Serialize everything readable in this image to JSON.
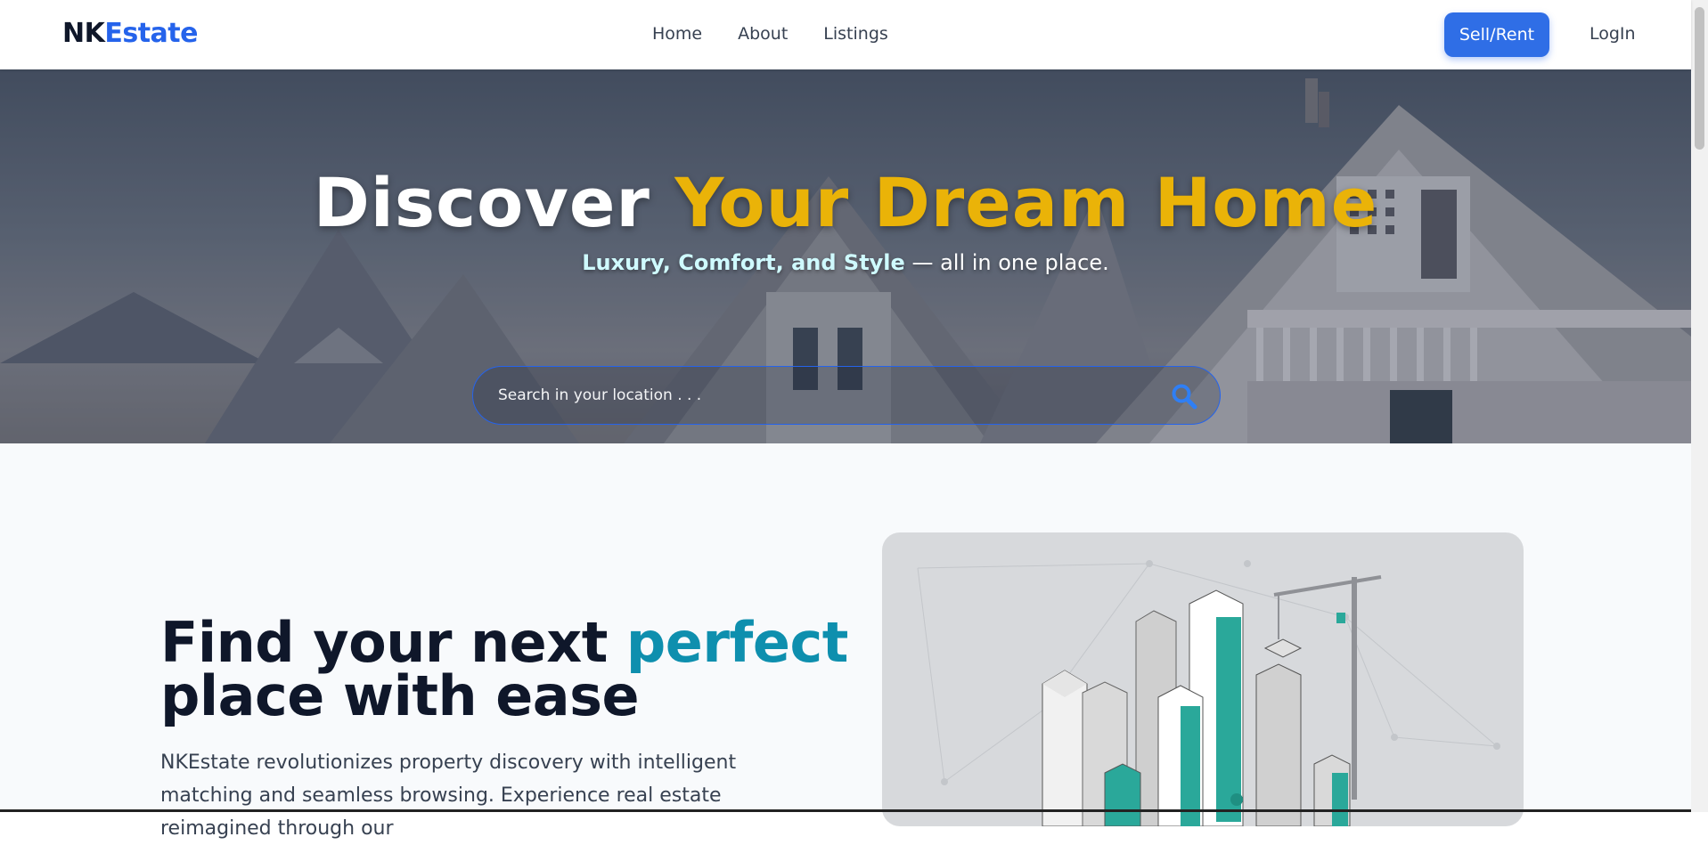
{
  "nav": {
    "logo_part1": "NK",
    "logo_part2": "Estate",
    "links": [
      "Home",
      "About",
      "Listings"
    ],
    "sell_button": "Sell/Rent",
    "login": "LogIn"
  },
  "hero": {
    "title_part1": "Discover ",
    "title_highlight": "Your Dream Home",
    "subtitle_strong": "Luxury, Comfort, and Style",
    "subtitle_rest": " — all in one place.",
    "search_placeholder": "Search in your location . . ."
  },
  "feature": {
    "headline_part1": "Find your next ",
    "headline_accent": "perfect",
    "headline_part2": "place with ease",
    "description": "NKEstate revolutionizes property discovery with intelligent matching and seamless browsing. Experience real estate reimagined through our"
  },
  "colors": {
    "brand_blue": "#2563eb",
    "hero_highlight": "#eab308",
    "headline_accent": "#0e8fae"
  },
  "icons": [
    "search-icon"
  ]
}
